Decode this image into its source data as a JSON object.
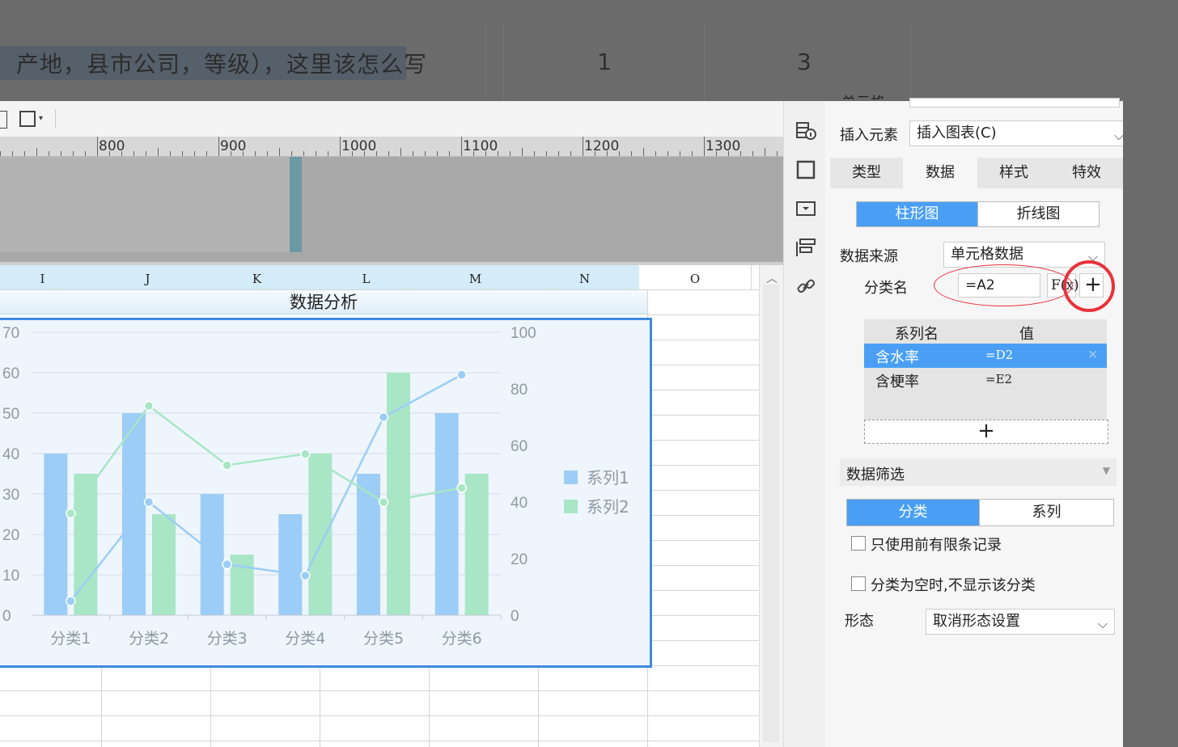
{
  "question": {
    "text": "产地，县市公司，等级），这里该怎么写",
    "num1": "1",
    "num2": "3"
  },
  "ruler": {
    "labels": [
      "800",
      "900",
      "1000",
      "1100",
      "1200",
      "1300"
    ]
  },
  "columns": [
    "I",
    "J",
    "K",
    "L",
    "M",
    "N",
    "O"
  ],
  "sheet_title": "数据分析",
  "chart_data": {
    "type": "bar",
    "categories": [
      "分类1",
      "分类2",
      "分类3",
      "分类4",
      "分类5",
      "分类6"
    ],
    "y_left_ticks": [
      "0",
      "10",
      "20",
      "30",
      "40",
      "50",
      "60",
      "70"
    ],
    "y_right_ticks": [
      "0",
      "20",
      "40",
      "60",
      "80",
      "100"
    ],
    "ylim_left": [
      0,
      70
    ],
    "ylim_right": [
      0,
      100
    ],
    "series": [
      {
        "name": "系列1",
        "values": [
          40,
          50,
          30,
          25,
          35,
          50
        ],
        "color": "#9ccdf6"
      },
      {
        "name": "系列2",
        "values": [
          35,
          25,
          15,
          40,
          60,
          35
        ],
        "color": "#a8e6c6"
      }
    ],
    "lines": [
      {
        "values": [
          5,
          40,
          18,
          14,
          70,
          85
        ],
        "axis": "right",
        "color": "#9ccdf6"
      },
      {
        "values": [
          36,
          74,
          53,
          57,
          40,
          45
        ],
        "axis": "right",
        "color": "#a8e6c6"
      }
    ],
    "legend": "right"
  },
  "panel": {
    "top_partial_label": "单元格",
    "insert_element_label": "插入元素",
    "insert_element_value": "插入图表(C)",
    "tabs": [
      "类型",
      "数据",
      "样式",
      "特效"
    ],
    "chart_kinds": [
      "柱形图",
      "折线图"
    ],
    "data_source_label": "数据来源",
    "data_source_value": "单元格数据",
    "category_name_label": "分类名",
    "category_name_value": "=A2",
    "fx_label": "F(x)",
    "add_label": "+",
    "series_header_name": "系列名",
    "series_header_value": "值",
    "series_rows": [
      {
        "name": "含水率",
        "value": "=D2"
      },
      {
        "name": "含梗率",
        "value": "=E2"
      }
    ],
    "add_series": "+",
    "filter_title": "数据筛选",
    "filter_tabs": [
      "分类",
      "系列"
    ],
    "check1": "只使用前有限条记录",
    "check2": "分类为空时,不显示该分类",
    "form_label": "形态",
    "form_value": "取消形态设置"
  },
  "colors": {
    "accent": "#4a9ff5",
    "annotation_red": "#e8323c",
    "chart_border": "#3e8ae0"
  }
}
